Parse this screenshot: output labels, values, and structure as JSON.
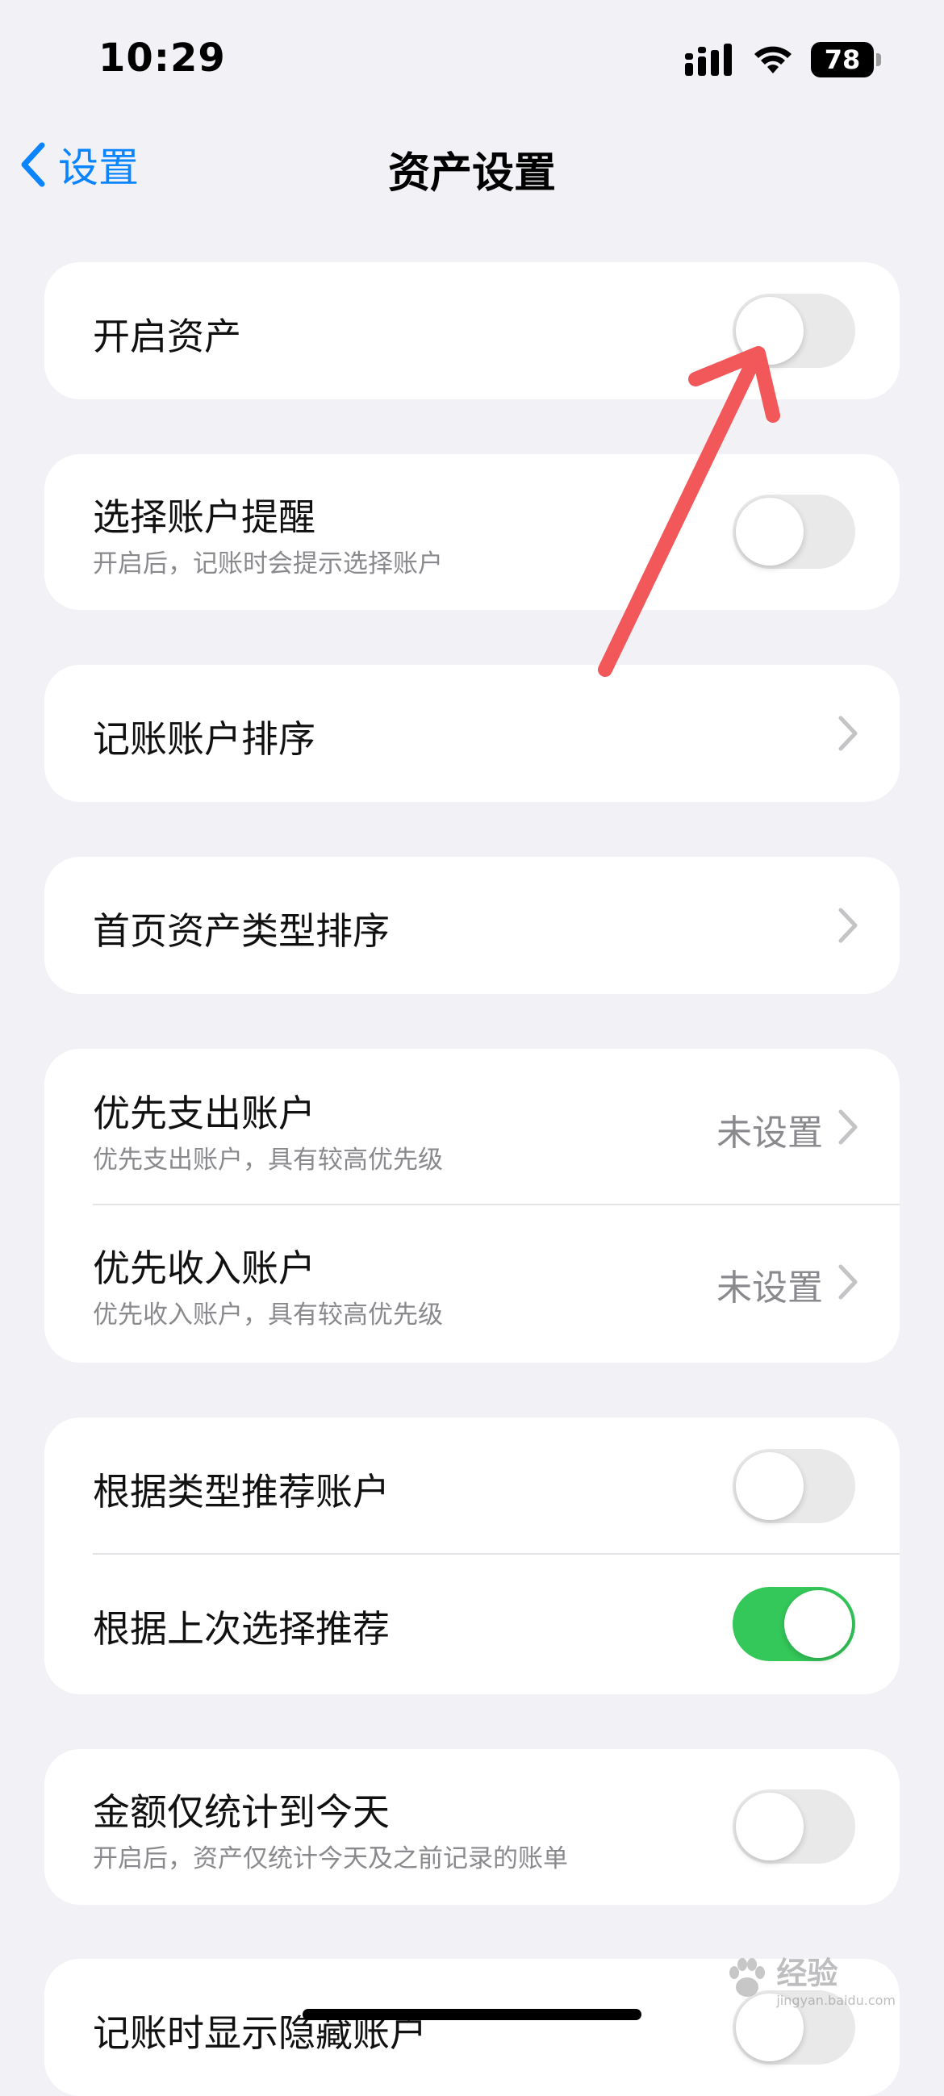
{
  "status_bar": {
    "time": "10:29",
    "battery_level": "78",
    "icons": [
      "cellular-signal-icon",
      "wifi-icon",
      "battery-icon"
    ]
  },
  "nav": {
    "back_label": "设置",
    "title": "资产设置",
    "accent_color": "#0a84ff"
  },
  "settings": {
    "enable_assets": {
      "label": "开启资产",
      "enabled": false
    },
    "account_reminder": {
      "label": "选择账户提醒",
      "description": "开启后，记账时会提示选择账户",
      "enabled": false
    },
    "account_sort": {
      "label": "记账账户排序"
    },
    "home_asset_type_sort": {
      "label": "首页资产类型排序"
    },
    "priority_expense": {
      "label": "优先支出账户",
      "description": "优先支出账户，具有较高优先级",
      "value": "未设置"
    },
    "priority_income": {
      "label": "优先收入账户",
      "description": "优先收入账户，具有较高优先级",
      "value": "未设置"
    },
    "recommend_by_type": {
      "label": "根据类型推荐账户",
      "enabled": false
    },
    "recommend_by_last": {
      "label": "根据上次选择推荐",
      "enabled": true
    },
    "amount_until_today": {
      "label": "金额仅统计到今天",
      "description": "开启后，资产仅统计今天及之前记录的账单",
      "enabled": false
    },
    "show_hidden_accounts": {
      "label": "记账时显示隐藏账户",
      "enabled": false
    }
  },
  "colors": {
    "toggle_on": "#34c759",
    "toggle_off": "#e9e9ea",
    "annotation_arrow": "#f2575a"
  },
  "watermark": {
    "text": "经验",
    "domain": "jingyan.baidu.com"
  }
}
